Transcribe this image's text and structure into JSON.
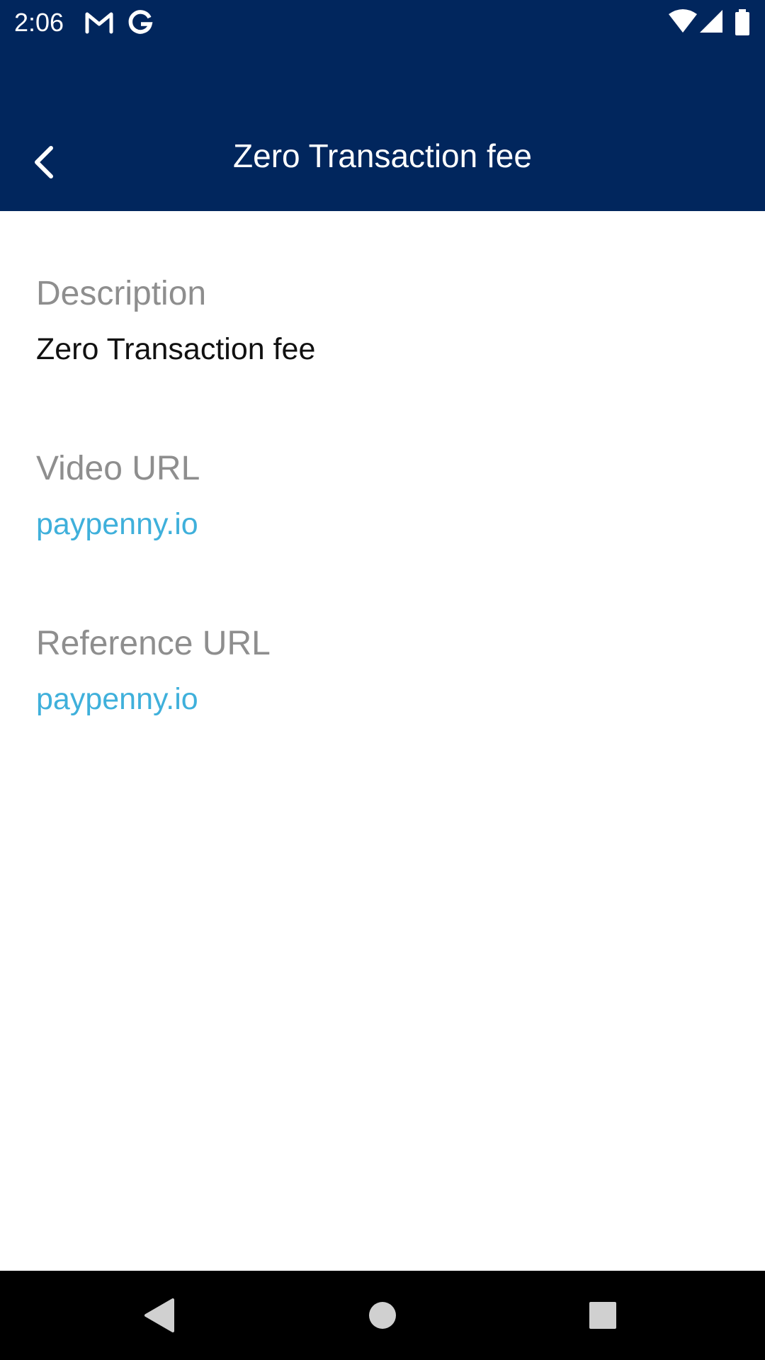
{
  "status_bar": {
    "time": "2:06",
    "icons": [
      "gmail-icon",
      "google-icon",
      "wifi-icon",
      "signal-icon",
      "battery-icon"
    ]
  },
  "app_bar": {
    "title": "Zero Transaction fee",
    "back_icon": "chevron-left-icon"
  },
  "details": {
    "description": {
      "label": "Description",
      "value": "Zero Transaction fee"
    },
    "video_url": {
      "label": "Video URL",
      "value": "paypenny.io"
    },
    "reference_url": {
      "label": "Reference URL",
      "value": "paypenny.io"
    }
  },
  "nav_bar": {
    "icons": [
      "back-triangle-icon",
      "home-circle-icon",
      "recents-square-icon"
    ]
  },
  "colors": {
    "header_bg": "#01265d",
    "label": "#8e8e8e",
    "value": "#111111",
    "link": "#3fb0db",
    "nav_bg": "#000000"
  }
}
